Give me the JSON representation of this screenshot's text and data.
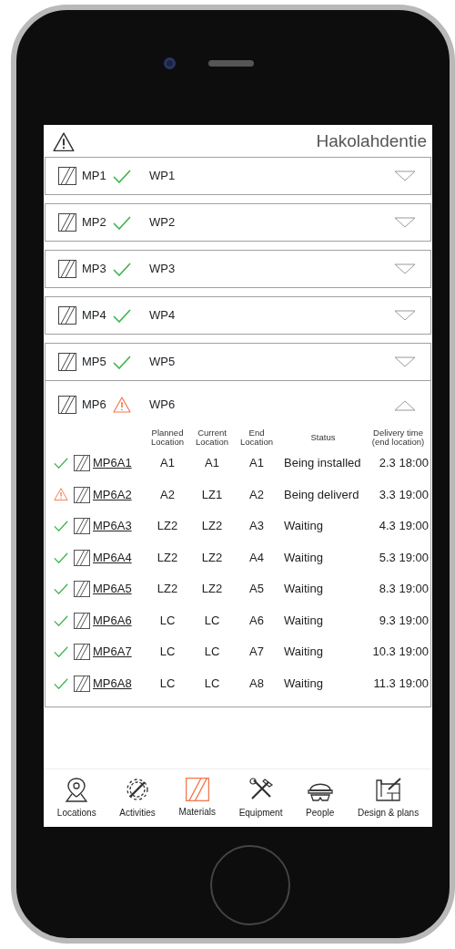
{
  "header": {
    "title": "Hakolahdentie"
  },
  "packages": [
    {
      "code": "MP1",
      "warning": false,
      "wp": "WP1",
      "expanded": false
    },
    {
      "code": "MP2",
      "warning": false,
      "wp": "WP2",
      "expanded": false
    },
    {
      "code": "MP3",
      "warning": false,
      "wp": "WP3",
      "expanded": false
    },
    {
      "code": "MP4",
      "warning": false,
      "wp": "WP4",
      "expanded": false
    },
    {
      "code": "MP5",
      "warning": false,
      "wp": "WP5",
      "expanded": false
    },
    {
      "code": "MP6",
      "warning": true,
      "wp": "WP6",
      "expanded": true,
      "columns": [
        "Planned Location",
        "Current Location",
        "End Location",
        "Status",
        "Delivery time (end location)"
      ],
      "rows": [
        {
          "warning": false,
          "id": "MP6A1",
          "planned": "A1",
          "current": "A1",
          "end": "A1",
          "state": "Being installed",
          "delivery": "2.3 18:00"
        },
        {
          "warning": true,
          "id": "MP6A2",
          "planned": "A2",
          "current": "LZ1",
          "end": "A2",
          "state": "Being deliverd",
          "delivery": "3.3 19:00"
        },
        {
          "warning": false,
          "id": "MP6A3",
          "planned": "LZ2",
          "current": "LZ2",
          "end": "A3",
          "state": "Waiting",
          "delivery": "4.3 19:00"
        },
        {
          "warning": false,
          "id": "MP6A4",
          "planned": "LZ2",
          "current": "LZ2",
          "end": "A4",
          "state": "Waiting",
          "delivery": "5.3 19:00"
        },
        {
          "warning": false,
          "id": "MP6A5",
          "planned": "LZ2",
          "current": "LZ2",
          "end": "A5",
          "state": "Waiting",
          "delivery": "8.3 19:00"
        },
        {
          "warning": false,
          "id": "MP6A6",
          "planned": "LC",
          "current": "LC",
          "end": "A6",
          "state": "Waiting",
          "delivery": "9.3 19:00"
        },
        {
          "warning": false,
          "id": "MP6A7",
          "planned": "LC",
          "current": "LC",
          "end": "A7",
          "state": "Waiting",
          "delivery": "10.3 19:00"
        },
        {
          "warning": false,
          "id": "MP6A8",
          "planned": "LC",
          "current": "LC",
          "end": "A8",
          "state": "Waiting",
          "delivery": "11.3 19:00"
        }
      ]
    }
  ],
  "nav": [
    {
      "label": "Locations",
      "selected": false
    },
    {
      "label": "Activities",
      "selected": false
    },
    {
      "label": "Materials",
      "selected": true
    },
    {
      "label": "Equipment",
      "selected": false
    },
    {
      "label": "People",
      "selected": false
    },
    {
      "label": "Design & plans",
      "selected": false
    }
  ]
}
